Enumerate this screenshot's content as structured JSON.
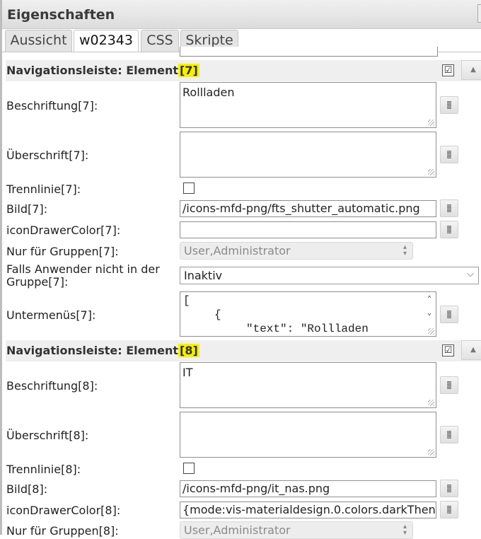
{
  "window": {
    "title": "Eigenschaften"
  },
  "tabs": [
    {
      "label": "Aussicht"
    },
    {
      "label": "w02343"
    },
    {
      "label": "CSS"
    },
    {
      "label": "Skripte"
    }
  ],
  "sections": [
    {
      "title_prefix": "Navigationsleiste: Element",
      "index_label": "[7]",
      "enabled": "☑",
      "fields": {
        "beschriftung_label": "Beschriftung[7]:",
        "beschriftung_value": "Rollladen",
        "ueberschrift_label": "Überschrift[7]:",
        "ueberschrift_value": "",
        "trennlinie_label": "Trennlinie[7]:",
        "bild_label": "Bild[7]:",
        "bild_value": "/icons-mfd-png/fts_shutter_automatic.png",
        "icon_color_label": "iconDrawerColor[7]:",
        "icon_color_value": "",
        "gruppen_label": "Nur für Gruppen[7]:",
        "gruppen_value": "User,Administrator",
        "falls_label": "Falls Anwender nicht in der Gruppe[7]:",
        "falls_value": "Inaktiv",
        "untermenues_label": "Untermenüs[7]:",
        "untermenues_lines": [
          "[",
          "{",
          "\"text\": \"Rollladen"
        ]
      }
    },
    {
      "title_prefix": "Navigationsleiste: Element",
      "index_label": "[8]",
      "enabled": "☑",
      "fields": {
        "beschriftung_label": "Beschriftung[8]:",
        "beschriftung_value": "IT",
        "ueberschrift_label": "Überschrift[8]:",
        "ueberschrift_value": "",
        "trennlinie_label": "Trennlinie[8]:",
        "bild_label": "Bild[8]:",
        "bild_value": "/icons-mfd-png/it_nas.png",
        "icon_color_label": "iconDrawerColor[8]:",
        "icon_color_value": "{mode:vis-materialdesign.0.colors.darkThen",
        "gruppen_label": "Nur für Gruppen[8]:",
        "gruppen_value": "User,Administrator"
      }
    }
  ],
  "icons": {
    "collapse": "chevron-up-icon",
    "side_button": "edit-dialog-icon",
    "select_arrow": "chevron-down-icon"
  }
}
